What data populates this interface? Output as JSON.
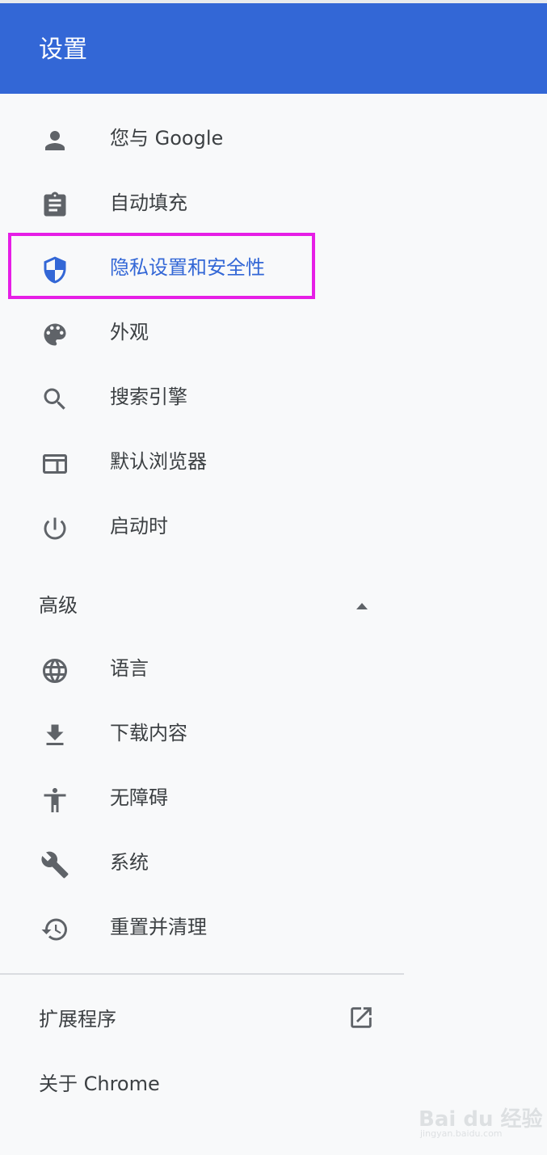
{
  "header": {
    "title": "设置"
  },
  "menu": {
    "items": [
      {
        "label": "您与 Google",
        "icon": "person-icon"
      },
      {
        "label": "自动填充",
        "icon": "clipboard-icon"
      },
      {
        "label": "隐私设置和安全性",
        "icon": "shield-icon",
        "active": true
      },
      {
        "label": "外观",
        "icon": "palette-icon"
      },
      {
        "label": "搜索引擎",
        "icon": "search-icon"
      },
      {
        "label": "默认浏览器",
        "icon": "browser-icon"
      },
      {
        "label": "启动时",
        "icon": "power-icon"
      }
    ]
  },
  "advanced": {
    "label": "高级",
    "arrow": "caret-up-icon",
    "items": [
      {
        "label": "语言",
        "icon": "globe-icon"
      },
      {
        "label": "下载内容",
        "icon": "download-icon"
      },
      {
        "label": "无障碍",
        "icon": "accessibility-icon"
      },
      {
        "label": "系统",
        "icon": "wrench-icon"
      },
      {
        "label": "重置并清理",
        "icon": "restore-icon"
      }
    ]
  },
  "footer": {
    "extensions_label": "扩展程序",
    "extensions_icon": "open-in-new-icon",
    "about_label": "关于 Chrome"
  },
  "watermark": {
    "main": "Bai du 经验",
    "sub": "jingyan.baidu.com"
  },
  "colors": {
    "header": "#3367d6",
    "active": "#3367d6",
    "highlight": "#e61ee6",
    "icon": "#5f6368"
  }
}
